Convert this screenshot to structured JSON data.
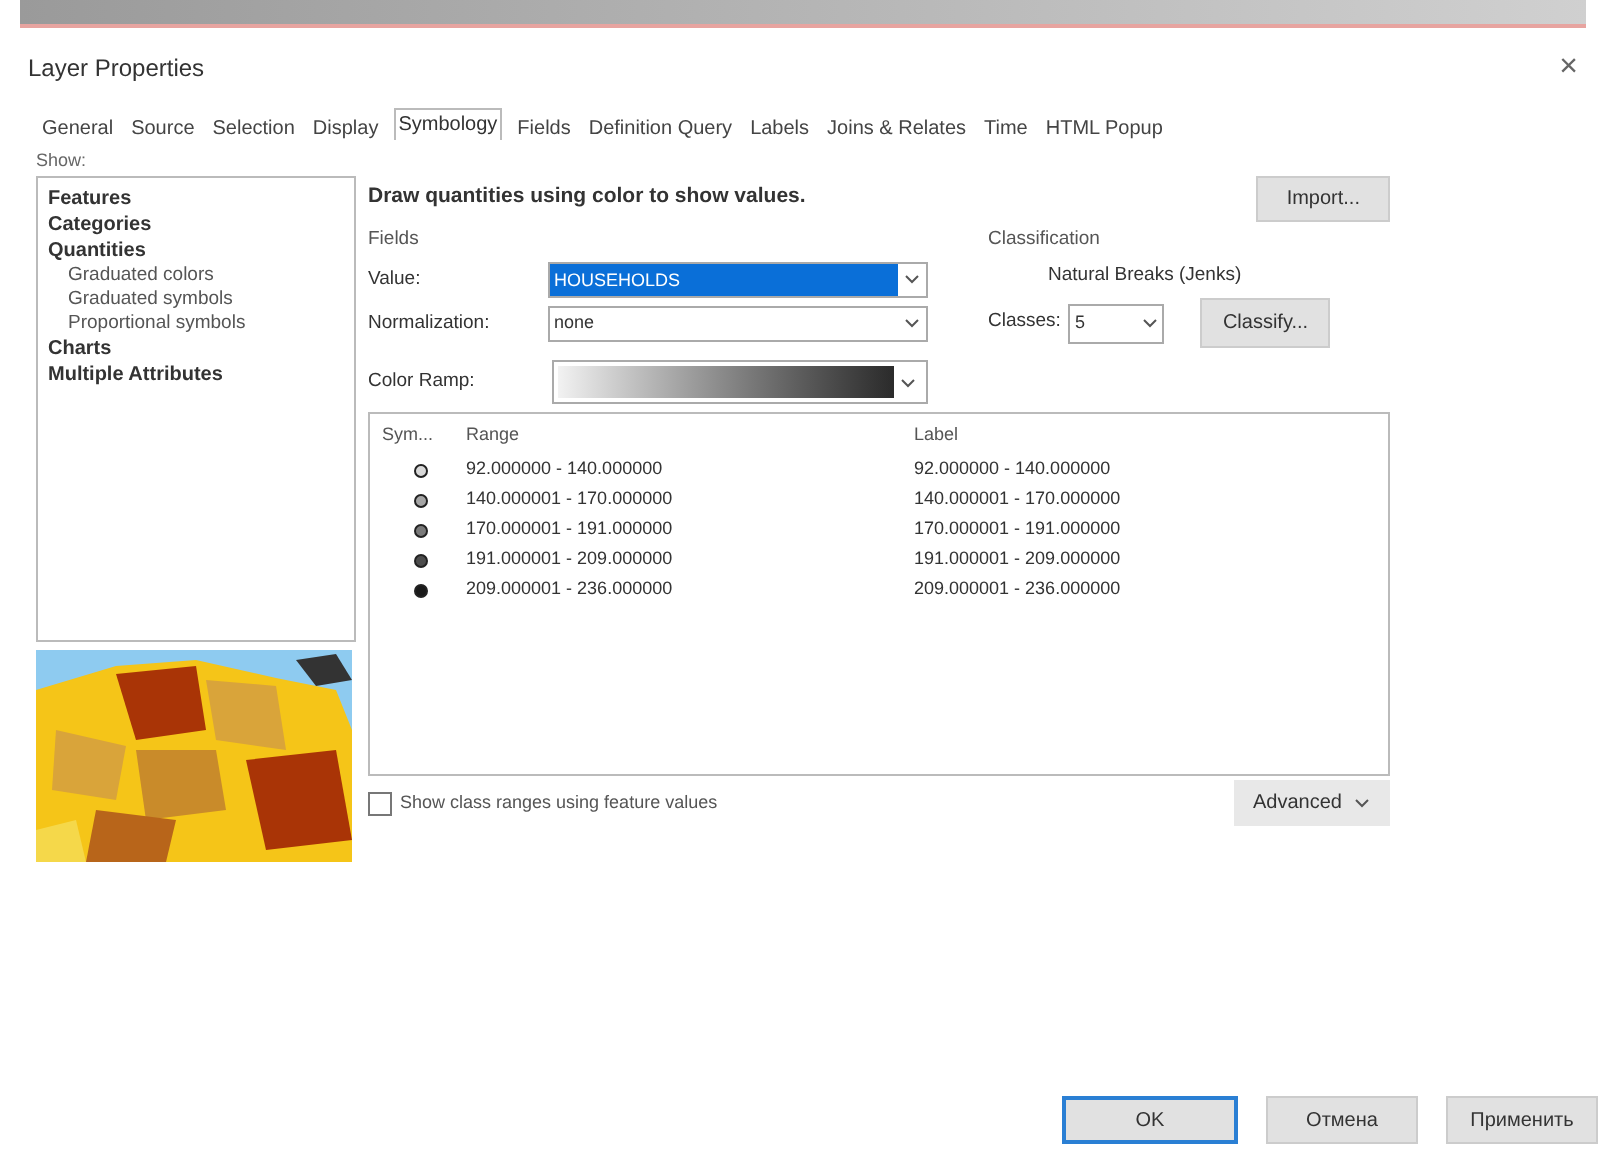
{
  "window": {
    "title": "Layer Properties",
    "close": "×"
  },
  "tabs": [
    {
      "label": "General",
      "selected": false
    },
    {
      "label": "Source",
      "selected": false
    },
    {
      "label": "Selection",
      "selected": false
    },
    {
      "label": "Display",
      "selected": false
    },
    {
      "label": "Symbology",
      "selected": true
    },
    {
      "label": "Fields",
      "selected": false
    },
    {
      "label": "Definition Query",
      "selected": false
    },
    {
      "label": "Labels",
      "selected": false
    },
    {
      "label": "Joins & Relates",
      "selected": false
    },
    {
      "label": "Time",
      "selected": false
    },
    {
      "label": "HTML Popup",
      "selected": false
    }
  ],
  "show": {
    "label": "Show:",
    "items": [
      {
        "label": "Features"
      },
      {
        "label": "Categories"
      },
      {
        "label": "Quantities",
        "children": [
          {
            "label": "Graduated colors"
          },
          {
            "label": "Graduated symbols"
          },
          {
            "label": "Proportional symbols"
          }
        ]
      },
      {
        "label": "Charts"
      },
      {
        "label": "Multiple Attributes"
      }
    ]
  },
  "heading": "Draw quantities using color to show values.",
  "import_button": "Import...",
  "fields": {
    "label": "Fields",
    "value_label": "Value:",
    "value": "HOUSEHOLDS",
    "normalization_label": "Normalization:",
    "normalization": "none"
  },
  "classification": {
    "label": "Classification",
    "method": "Natural Breaks (Jenks)",
    "classes_label": "Classes:",
    "classes": "5",
    "classify_button": "Classify..."
  },
  "color_ramp": {
    "label": "Color Ramp:"
  },
  "table": {
    "columns": [
      "Sym...",
      "Range",
      "Label"
    ],
    "rows": [
      {
        "color": "#d9d9d9",
        "range": "92.000000 - 140.000000",
        "label": "92.000000 - 140.000000"
      },
      {
        "color": "#a6a6a6",
        "range": "140.000001 - 170.000000",
        "label": "140.000001 - 170.000000"
      },
      {
        "color": "#7a7a7a",
        "range": "170.000001 - 191.000000",
        "label": "170.000001 - 191.000000"
      },
      {
        "color": "#4d4d4d",
        "range": "191.000001 - 209.000000",
        "label": "191.000001 - 209.000000"
      },
      {
        "color": "#1a1a1a",
        "range": "209.000001 - 236.000000",
        "label": "209.000001 - 236.000000"
      }
    ]
  },
  "show_class_ranges": {
    "label": "Show class ranges using feature values",
    "checked": false
  },
  "advanced_button": "Advanced",
  "buttons": [
    {
      "label": "OK",
      "kind": "default"
    },
    {
      "label": "Отмена",
      "kind": "normal"
    },
    {
      "label": "Применить",
      "kind": "normal"
    }
  ]
}
